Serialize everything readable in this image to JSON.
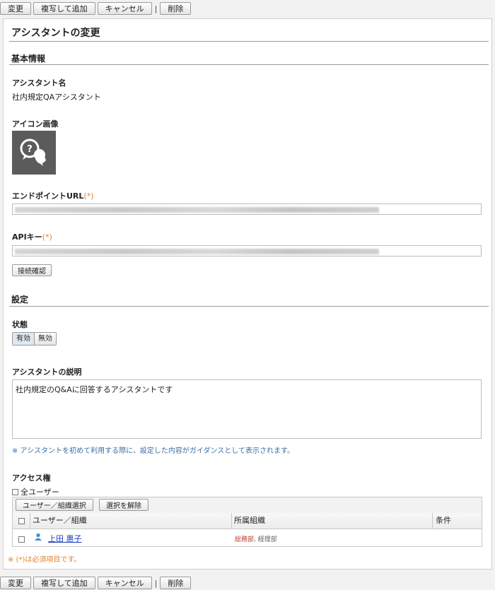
{
  "toolbar": {
    "change": "変更",
    "copy_add": "複写して追加",
    "cancel": "キャンセル",
    "separator": "|",
    "delete": "削除"
  },
  "page": {
    "title": "アシスタントの変更"
  },
  "basic": {
    "section_title": "基本情報",
    "name_label": "アシスタント名",
    "name_value": "社内規定QAアシスタント",
    "icon_label": "アイコン画像",
    "icon_name": "chat-question-person-icon",
    "endpoint_label": "エンドポイントURL",
    "api_label": "APIキー",
    "required_mark": "(*)",
    "connect_check": "接続確認"
  },
  "settings": {
    "section_title": "設定",
    "status_label": "状態",
    "status_on": "有効",
    "status_off": "無効",
    "status_selected": "有効",
    "description_label": "アシスタントの説明",
    "description_value": "社内規定のQ&Aに回答するアシスタントです",
    "description_note": "※ アシスタントを初めて利用する際に、設定した内容がガイダンスとして表示されます。",
    "access_label": "アクセス権",
    "all_users": "全ユーザー",
    "select_button": "ユーザー／組織選択",
    "clear_button": "選択を解除",
    "columns": [
      "ユーザー／組織",
      "所属組織",
      "条件"
    ],
    "rows": [
      {
        "name": "上田 惠子",
        "org_primary": "総務部",
        "org_secondary": ", 経理部",
        "condition": ""
      }
    ]
  },
  "footer_note": "※ (*)は必須項目です。",
  "colors": {
    "required": "#e0832f",
    "note": "#3b6fa5",
    "link": "#1b3fbf",
    "org_primary": "#c0392b"
  }
}
